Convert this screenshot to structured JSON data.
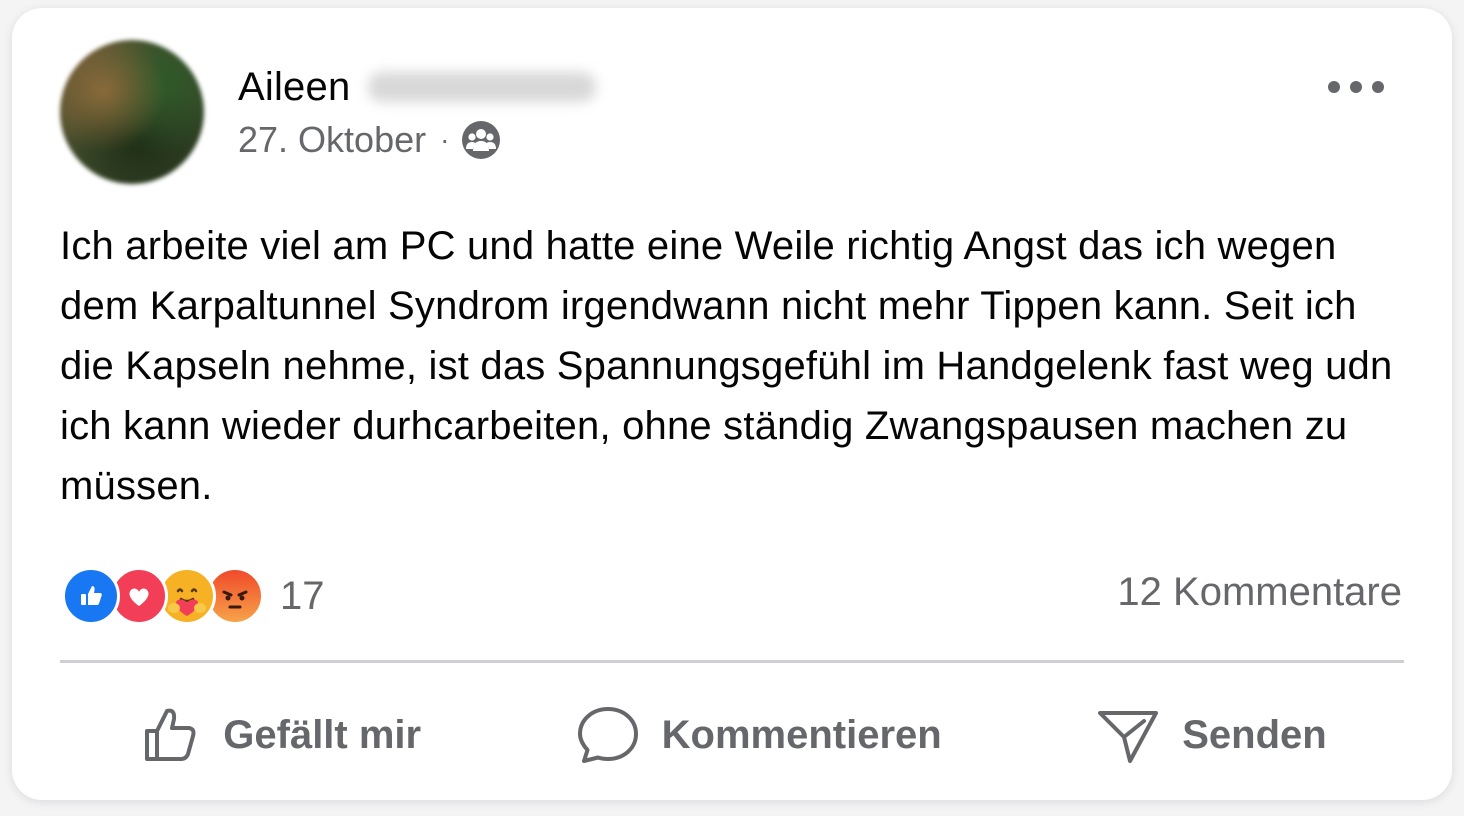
{
  "post": {
    "author_first_name": "Aileen",
    "date": "27. Oktober",
    "separator": "·",
    "audience_icon": "group-icon",
    "more_icon": "more-options-icon",
    "text": "Ich arbeite viel am PC und hatte eine Weile richtig Angst das ich wegen dem Karpaltunnel Syndrom irgendwann nicht mehr Tippen kann. Seit ich die Kapseln nehme, ist das Spannungsgefühl im Handgelenk fast weg udn ich kann wieder durhcarbeiten, ohne ständig Zwangspausen machen zu müssen."
  },
  "reactions": {
    "types": [
      "like",
      "love",
      "care",
      "angry"
    ],
    "count": "17"
  },
  "comments": {
    "count_label": "12 Kommentare"
  },
  "actions": {
    "like_label": "Gefällt mir",
    "comment_label": "Kommentieren",
    "send_label": "Senden"
  },
  "colors": {
    "text_primary": "#050505",
    "text_secondary": "#65676b",
    "like_blue": "#1877f2",
    "love_red": "#f33e58",
    "care_yellow": "#f7b125",
    "angry_orange": "#f04a2a",
    "divider": "#ced0d4"
  }
}
